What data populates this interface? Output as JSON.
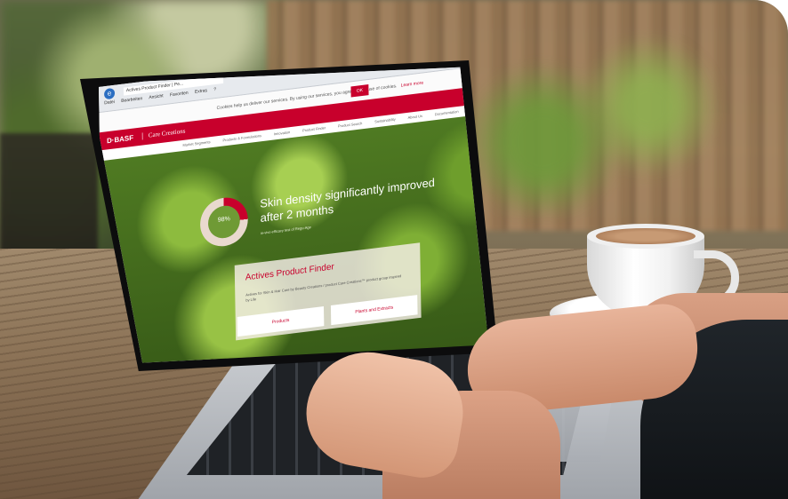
{
  "browser": {
    "tab_title": "Actives Product Finder | Pe...",
    "menu": [
      "Datei",
      "Bearbeiten",
      "Ansicht",
      "Favoriten",
      "Extras",
      "?"
    ]
  },
  "cookie_bar": {
    "text": "Cookies help us deliver our services. By using our services, you agree to our use of cookies.",
    "link": "Learn more",
    "button": "OK"
  },
  "site": {
    "brand": "D·BASF",
    "product_line": "Care Creations",
    "nav": [
      "Market Segments",
      "Products & Formulations",
      "Innovation",
      "Product Finder",
      "Product Search",
      "Sustainability",
      "About Us",
      "Documentation"
    ]
  },
  "hero": {
    "ring_value": "98%",
    "ring_fraction": 0.25,
    "headline": "Skin density significantly improved after 2 months",
    "sub": "in-vivo efficacy test of Regu-Age"
  },
  "finder": {
    "title": "Actives Product Finder",
    "text": "Actives for Skin & Hair Care by Beauty Creations / product Care Creations™ product group inspired by Life",
    "button_products": "Products",
    "button_plants": "Plants and Extracts"
  },
  "colors": {
    "brand_red": "#c8002c"
  }
}
